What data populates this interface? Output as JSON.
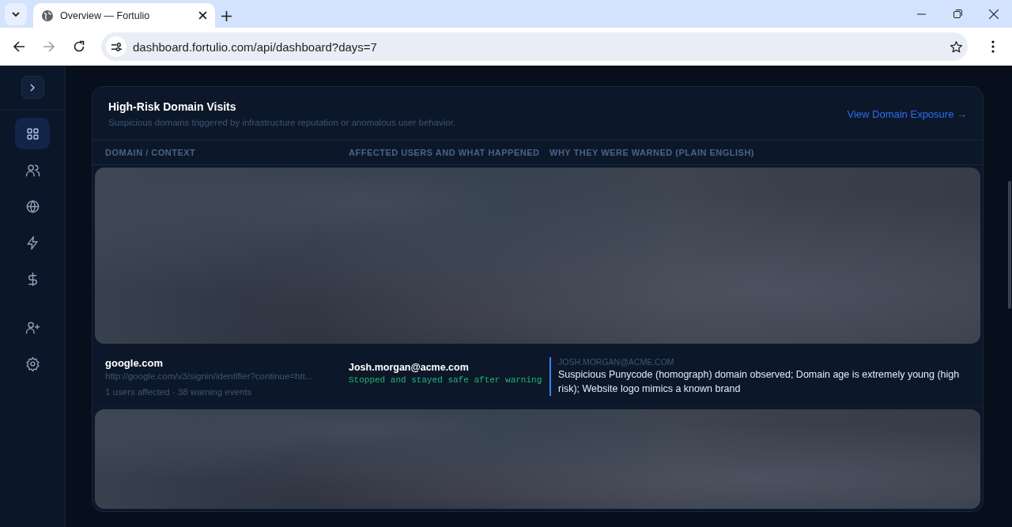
{
  "browser": {
    "tab_title": "Overview — Fortulio",
    "url": "dashboard.fortulio.com/api/dashboard?days=7"
  },
  "sidebar": {
    "items": [
      {
        "kind": "grid",
        "selected": true
      },
      {
        "kind": "users",
        "selected": false
      },
      {
        "kind": "globe",
        "selected": false
      },
      {
        "kind": "bolt",
        "selected": false
      },
      {
        "kind": "dollar",
        "selected": false
      },
      {
        "kind": "useradd",
        "selected": false
      },
      {
        "kind": "gear",
        "selected": false
      }
    ]
  },
  "card": {
    "title": "High-Risk Domain Visits",
    "subtitle": "Suspicious domains triggered by infrastructure reputation or anomalous user behavior.",
    "link": "View Domain Exposure →",
    "columns": [
      "DOMAIN / CONTEXT",
      "AFFECTED USERS AND WHAT HAPPENED",
      "WHY THEY WERE WARNED (PLAIN ENGLISH)"
    ],
    "rows": [
      {
        "kind": "redacted"
      },
      {
        "kind": "domain",
        "domain": "google.com",
        "url": "http://google.com/v3/signin/identifier?continue=htt...",
        "summary": "1 users affected · 38 warning events",
        "user": "Josh.morgan@acme.com",
        "outcome": "Stopped and stayed safe after warning",
        "reason_user": "JOSH.MORGAN@ACME.COM",
        "reason": "Suspicious Punycode (homograph) domain observed; Domain age is extremely young (high risk); Website logo mimics a known brand"
      },
      {
        "kind": "redacted"
      }
    ]
  }
}
